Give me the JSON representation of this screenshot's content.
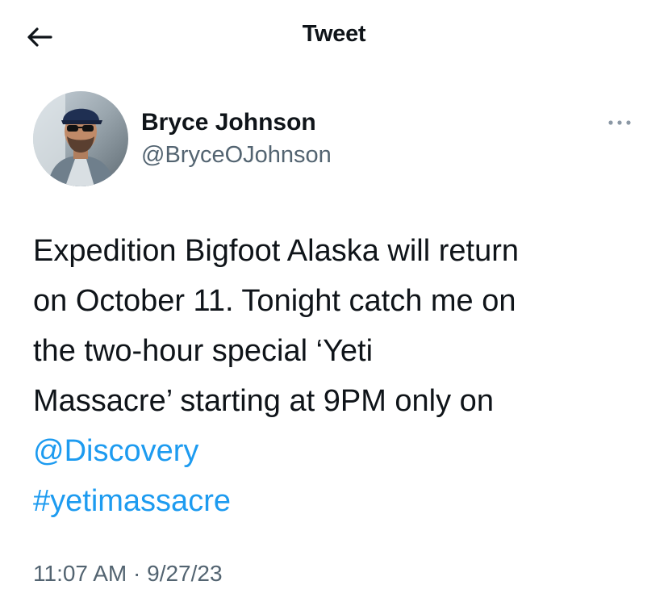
{
  "header": {
    "back_icon": "arrow-left-icon",
    "title": "Tweet"
  },
  "author": {
    "name": "Bryce Johnson",
    "handle": "@BryceOJohnson",
    "avatar_icon": "profile-photo",
    "more_icon": "more-horizontal-icon"
  },
  "tweet": {
    "lines": [
      "Expedition Bigfoot Alaska will return",
      "on October 11. Tonight catch me on",
      "the two-hour special ‘Yeti",
      "Massacre’ starting at 9PM only on"
    ],
    "mention": "@Discovery",
    "hashtag": "#yetimassacre"
  },
  "meta": {
    "time": "11:07 AM",
    "separator": "·",
    "date": "9/27/23"
  },
  "colors": {
    "text": "#0f1419",
    "secondary": "#536471",
    "link": "#1d9bf0"
  }
}
